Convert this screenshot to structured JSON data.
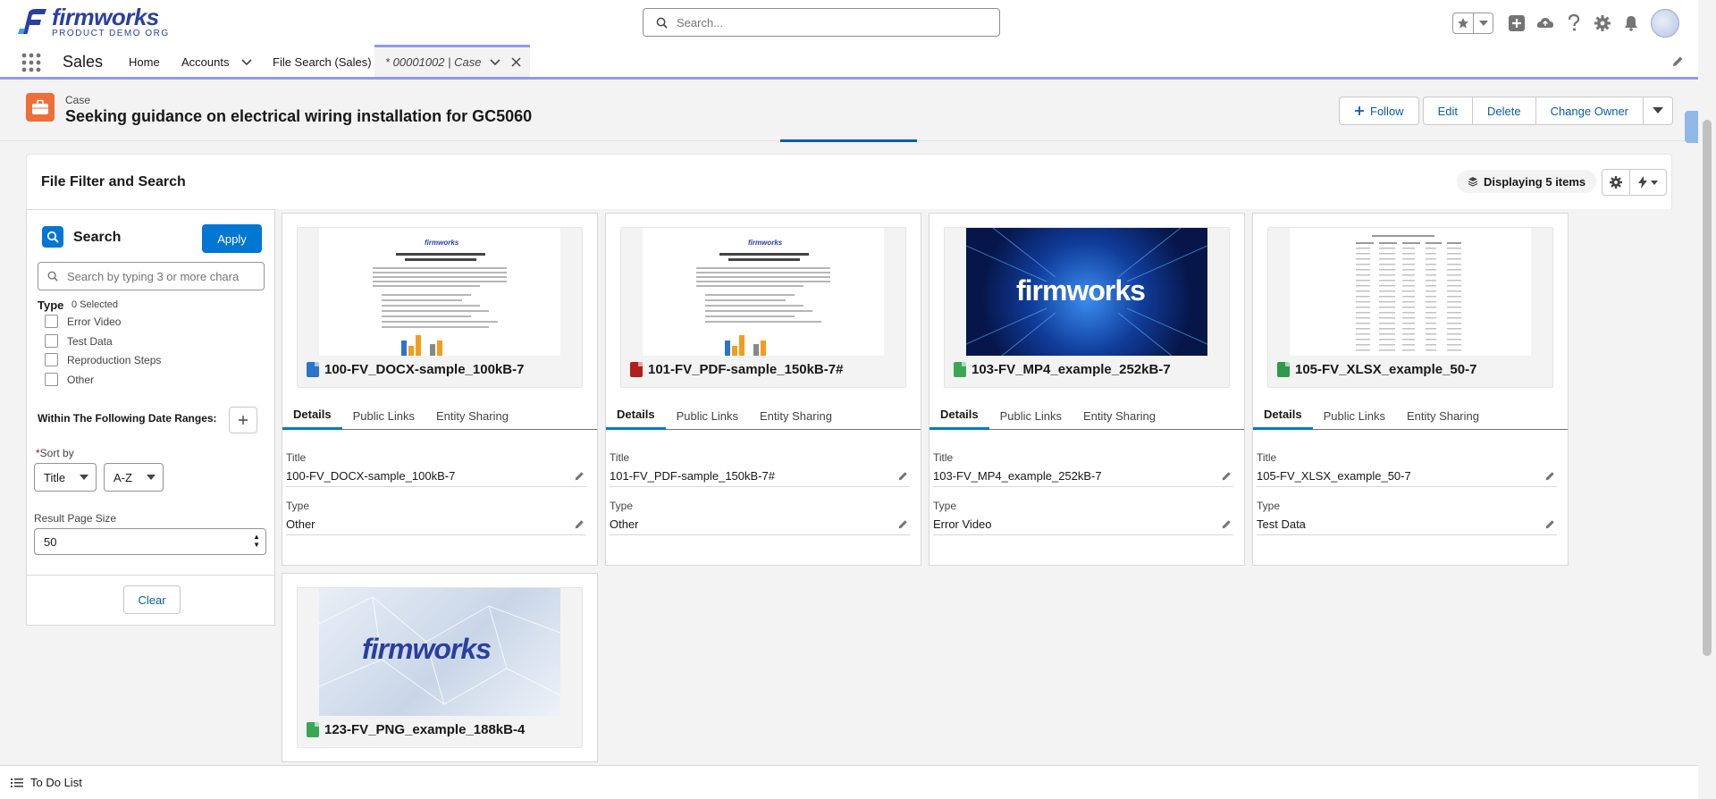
{
  "brand": {
    "name": "firmworks",
    "subtitle": "PRODUCT DEMO ORG",
    "color": "#2a3f9e"
  },
  "global_search": {
    "placeholder": "Search..."
  },
  "nav": {
    "app_name": "Sales",
    "items": [
      {
        "label": "Home"
      },
      {
        "label": "Accounts"
      },
      {
        "label": "File Search (Sales)"
      }
    ],
    "active_tab": {
      "label": "* 00001002 | Case"
    }
  },
  "record": {
    "entity": "Case",
    "title": "Seeking guidance on electrical wiring installation for GC5060",
    "actions": {
      "follow": "Follow",
      "edit": "Edit",
      "delete": "Delete",
      "change_owner": "Change Owner"
    }
  },
  "card": {
    "title": "File Filter and Search",
    "display_count": "Displaying 5 items"
  },
  "filter": {
    "heading": "Search",
    "apply": "Apply",
    "search_placeholder": "Search by typing 3 or more chara",
    "type_label": "Type",
    "type_selected": "0 Selected",
    "types": [
      "Error Video",
      "Test Data",
      "Reproduction Steps",
      "Other"
    ],
    "date_label": "Within The Following Date Ranges:",
    "sort_label": "Sort by",
    "sort_field": "Title",
    "sort_order": "A-Z",
    "page_size_label": "Result Page Size",
    "page_size": "50",
    "clear": "Clear"
  },
  "files": [
    {
      "name": "100-FV_DOCX-sample_100kB-7",
      "icon_color": "#2a74c9",
      "thumb": "doc",
      "tabs": [
        "Details",
        "Public Links",
        "Entity Sharing"
      ],
      "title_label": "Title",
      "title_value": "100-FV_DOCX-sample_100kB-7",
      "type_label": "Type",
      "type_value": "Other"
    },
    {
      "name": "101-FV_PDF-sample_150kB-7#",
      "icon_color": "#b11e1e",
      "thumb": "doc",
      "tabs": [
        "Details",
        "Public Links",
        "Entity Sharing"
      ],
      "title_label": "Title",
      "title_value": "101-FV_PDF-sample_150kB-7#",
      "type_label": "Type",
      "type_value": "Other"
    },
    {
      "name": "103-FV_MP4_example_252kB-7",
      "icon_color": "#3ba755",
      "thumb": "dark",
      "tabs": [
        "Details",
        "Public Links",
        "Entity Sharing"
      ],
      "title_label": "Title",
      "title_value": "103-FV_MP4_example_252kB-7",
      "type_label": "Type",
      "type_value": "Error Video"
    },
    {
      "name": "105-FV_XLSX_example_50-7",
      "icon_color": "#2e9a4b",
      "thumb": "sheet",
      "tabs": [
        "Details",
        "Public Links",
        "Entity Sharing"
      ],
      "title_label": "Title",
      "title_value": "105-FV_XLSX_example_50-7",
      "type_label": "Type",
      "type_value": "Test Data"
    },
    {
      "name": "123-FV_PNG_example_188kB-4",
      "icon_color": "#3ba755",
      "thumb": "light"
    }
  ],
  "thumbnail_logo_text": "firmworks",
  "utility": {
    "todo": "To Do List"
  }
}
